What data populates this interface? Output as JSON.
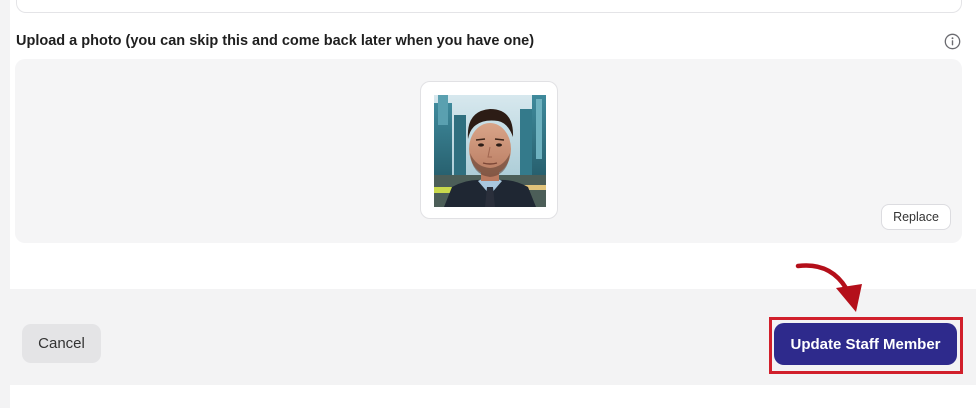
{
  "upload": {
    "label": "Upload a photo (you can skip this and come back later when you have one)",
    "info_icon": "info-circle-icon",
    "replace_label": "Replace",
    "photo": "staff-portrait"
  },
  "footer": {
    "cancel_label": "Cancel",
    "update_label": "Update Staff Member"
  },
  "annotation": {
    "highlight_color": "#d11f2b",
    "arrow_icon": "curved-arrow-icon"
  },
  "colors": {
    "primary": "#2e2a8c",
    "panel_bg": "#f5f5f6",
    "footer_bg": "#f3f3f4"
  }
}
